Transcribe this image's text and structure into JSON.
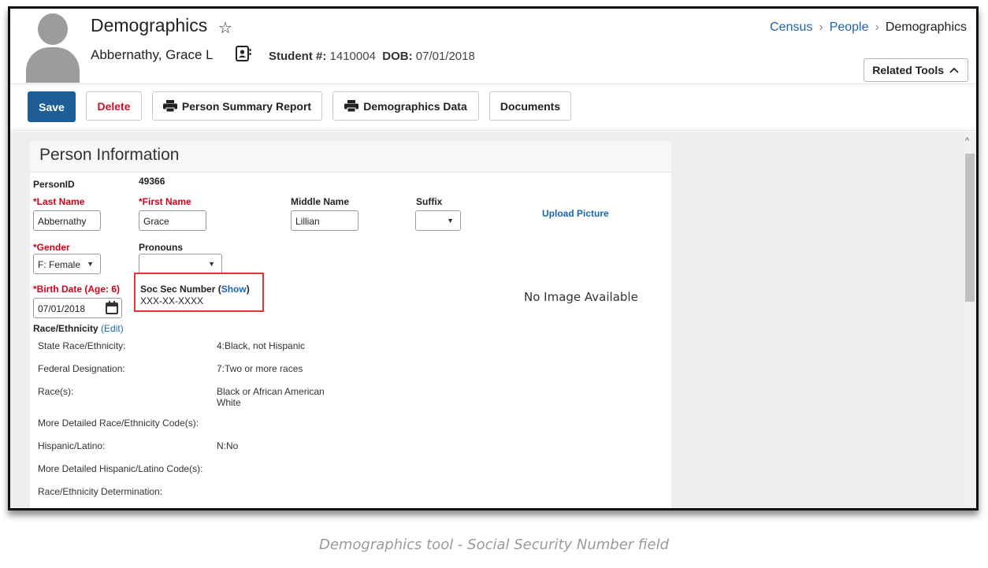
{
  "header": {
    "title": "Demographics",
    "student_name": "Abbernathy, Grace L",
    "student_num_label": "Student #:",
    "student_num": "1410004",
    "dob_label": "DOB:",
    "dob": "07/01/2018",
    "related_tools_label": "Related Tools"
  },
  "breadcrumb": [
    "Census",
    "People",
    "Demographics"
  ],
  "toolbar": {
    "save_label": "Save",
    "delete_label": "Delete",
    "person_summary_label": "Person Summary Report",
    "demographics_data_label": "Demographics Data",
    "documents_label": "Documents"
  },
  "panel": {
    "title": "Person Information",
    "person_id_label": "PersonID",
    "person_id": "49366",
    "last_name_label": "*Last Name",
    "last_name": "Abbernathy",
    "first_name_label": "*First Name",
    "first_name": "Grace",
    "middle_name_label": "Middle Name",
    "middle_name": "Lillian",
    "suffix_label": "Suffix",
    "suffix": "",
    "upload_picture": "Upload Picture",
    "gender_label": "*Gender",
    "gender": "F: Female",
    "pronouns_label": "Pronouns",
    "pronouns": "",
    "birth_date_label": "*Birth Date (Age: 6)",
    "birth_date": "07/01/2018",
    "ssn_label": "Soc Sec Number (",
    "ssn_show": "Show",
    "ssn_close": ")",
    "ssn_value": "XXX-XX-XXXX",
    "no_image": "No Image Available",
    "race_label": "Race/Ethnicity",
    "race_edit": "(Edit)",
    "rows": [
      {
        "label": "State Race/Ethnicity:",
        "value": "4:Black, not Hispanic"
      },
      {
        "label": "Federal Designation:",
        "value": "7:Two or more races"
      },
      {
        "label": "Race(s):",
        "value": "Black or African American",
        "value2": "White"
      },
      {
        "label": "More Detailed Race/Ethnicity Code(s):",
        "value": ""
      },
      {
        "label": "Hispanic/Latino:",
        "value": "N:No"
      },
      {
        "label": "More Detailed Hispanic/Latino Code(s):",
        "value": ""
      },
      {
        "label": "Race/Ethnicity Determination:",
        "value": ""
      }
    ]
  },
  "caption": "Demographics tool - Social Security Number field",
  "colors": {
    "primary": "#1d5e99",
    "danger": "#c8102e",
    "link": "#1c66b0",
    "highlight": "#e03535"
  },
  "icons": [
    "star-icon",
    "contact-card-icon",
    "chevron-up-icon",
    "printer-icon",
    "calendar-icon",
    "chevron-down-icon"
  ]
}
